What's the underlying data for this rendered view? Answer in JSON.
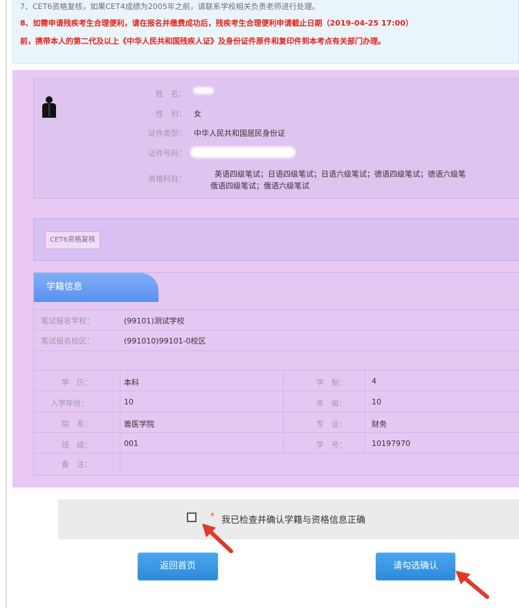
{
  "notice": {
    "line7": "7、CET6资格复核，如果CET4成绩为2005年之前，请联系学校相关负责老师进行处理。",
    "line8a": "8、如需申请残疾考生合理便利，请在报名并缴费成功后，残疾考生合理便利申请截止日期（2019-04-25 17:00）",
    "line8b": "前，携带本人的第二代及以上《中华人民共和国残疾人证》及身份证件原件和复印件到本考点有关部门办理。"
  },
  "profile": {
    "avatar_icon": "person-silhouette-icon",
    "name_label": "姓　名：",
    "gender_label": "性　别：",
    "gender_value": "女",
    "idtype_label": "证件类型：",
    "idtype_value": "中华人民共和国居民身份证",
    "idnum_label": "证件号码：",
    "subjects_label": "资格科目：",
    "subjects_line1": "英语四级笔试；日语四级笔试；日语六级笔试；德语四级笔试；德语六级笔",
    "subjects_line2": "俄语四级笔试；俄语六级笔试"
  },
  "tags": {
    "cet6_review": "CET6资格复核"
  },
  "registration": {
    "tab_title": "学籍信息",
    "school_label": "笔试报名学校：",
    "school_value": "(99101)测试学校",
    "campus_label": "笔试报名校区：",
    "campus_value": "(991010)99101-0校区",
    "rows": [
      {
        "l1": "学　历：",
        "v1": "本科",
        "l2": "学　制：",
        "v2": "4"
      },
      {
        "l1": "入学年份：",
        "v1": "10",
        "l2": "年　级：",
        "v2": "10"
      },
      {
        "l1": "院　系：",
        "v1": "兽医学院",
        "l2": "专　业：",
        "v2": "财务"
      },
      {
        "l1": "班　级：",
        "v1": "001",
        "l2": "学　号：",
        "v2": "10197970"
      }
    ],
    "remark_label": "备　注：",
    "remark_value": ""
  },
  "confirm": {
    "star": "*",
    "label": "我已检查并确认学籍与资格信息正确",
    "checked": false
  },
  "buttons": {
    "home": "返回首页",
    "confirm": "请勾选确认"
  },
  "colors": {
    "panel_bg": "#e9c9f4",
    "tab_blue": "#5a8ff0",
    "button_blue": "#2e8ad8",
    "warning_red": "#e0261c",
    "arrow_red": "#e0392b"
  }
}
